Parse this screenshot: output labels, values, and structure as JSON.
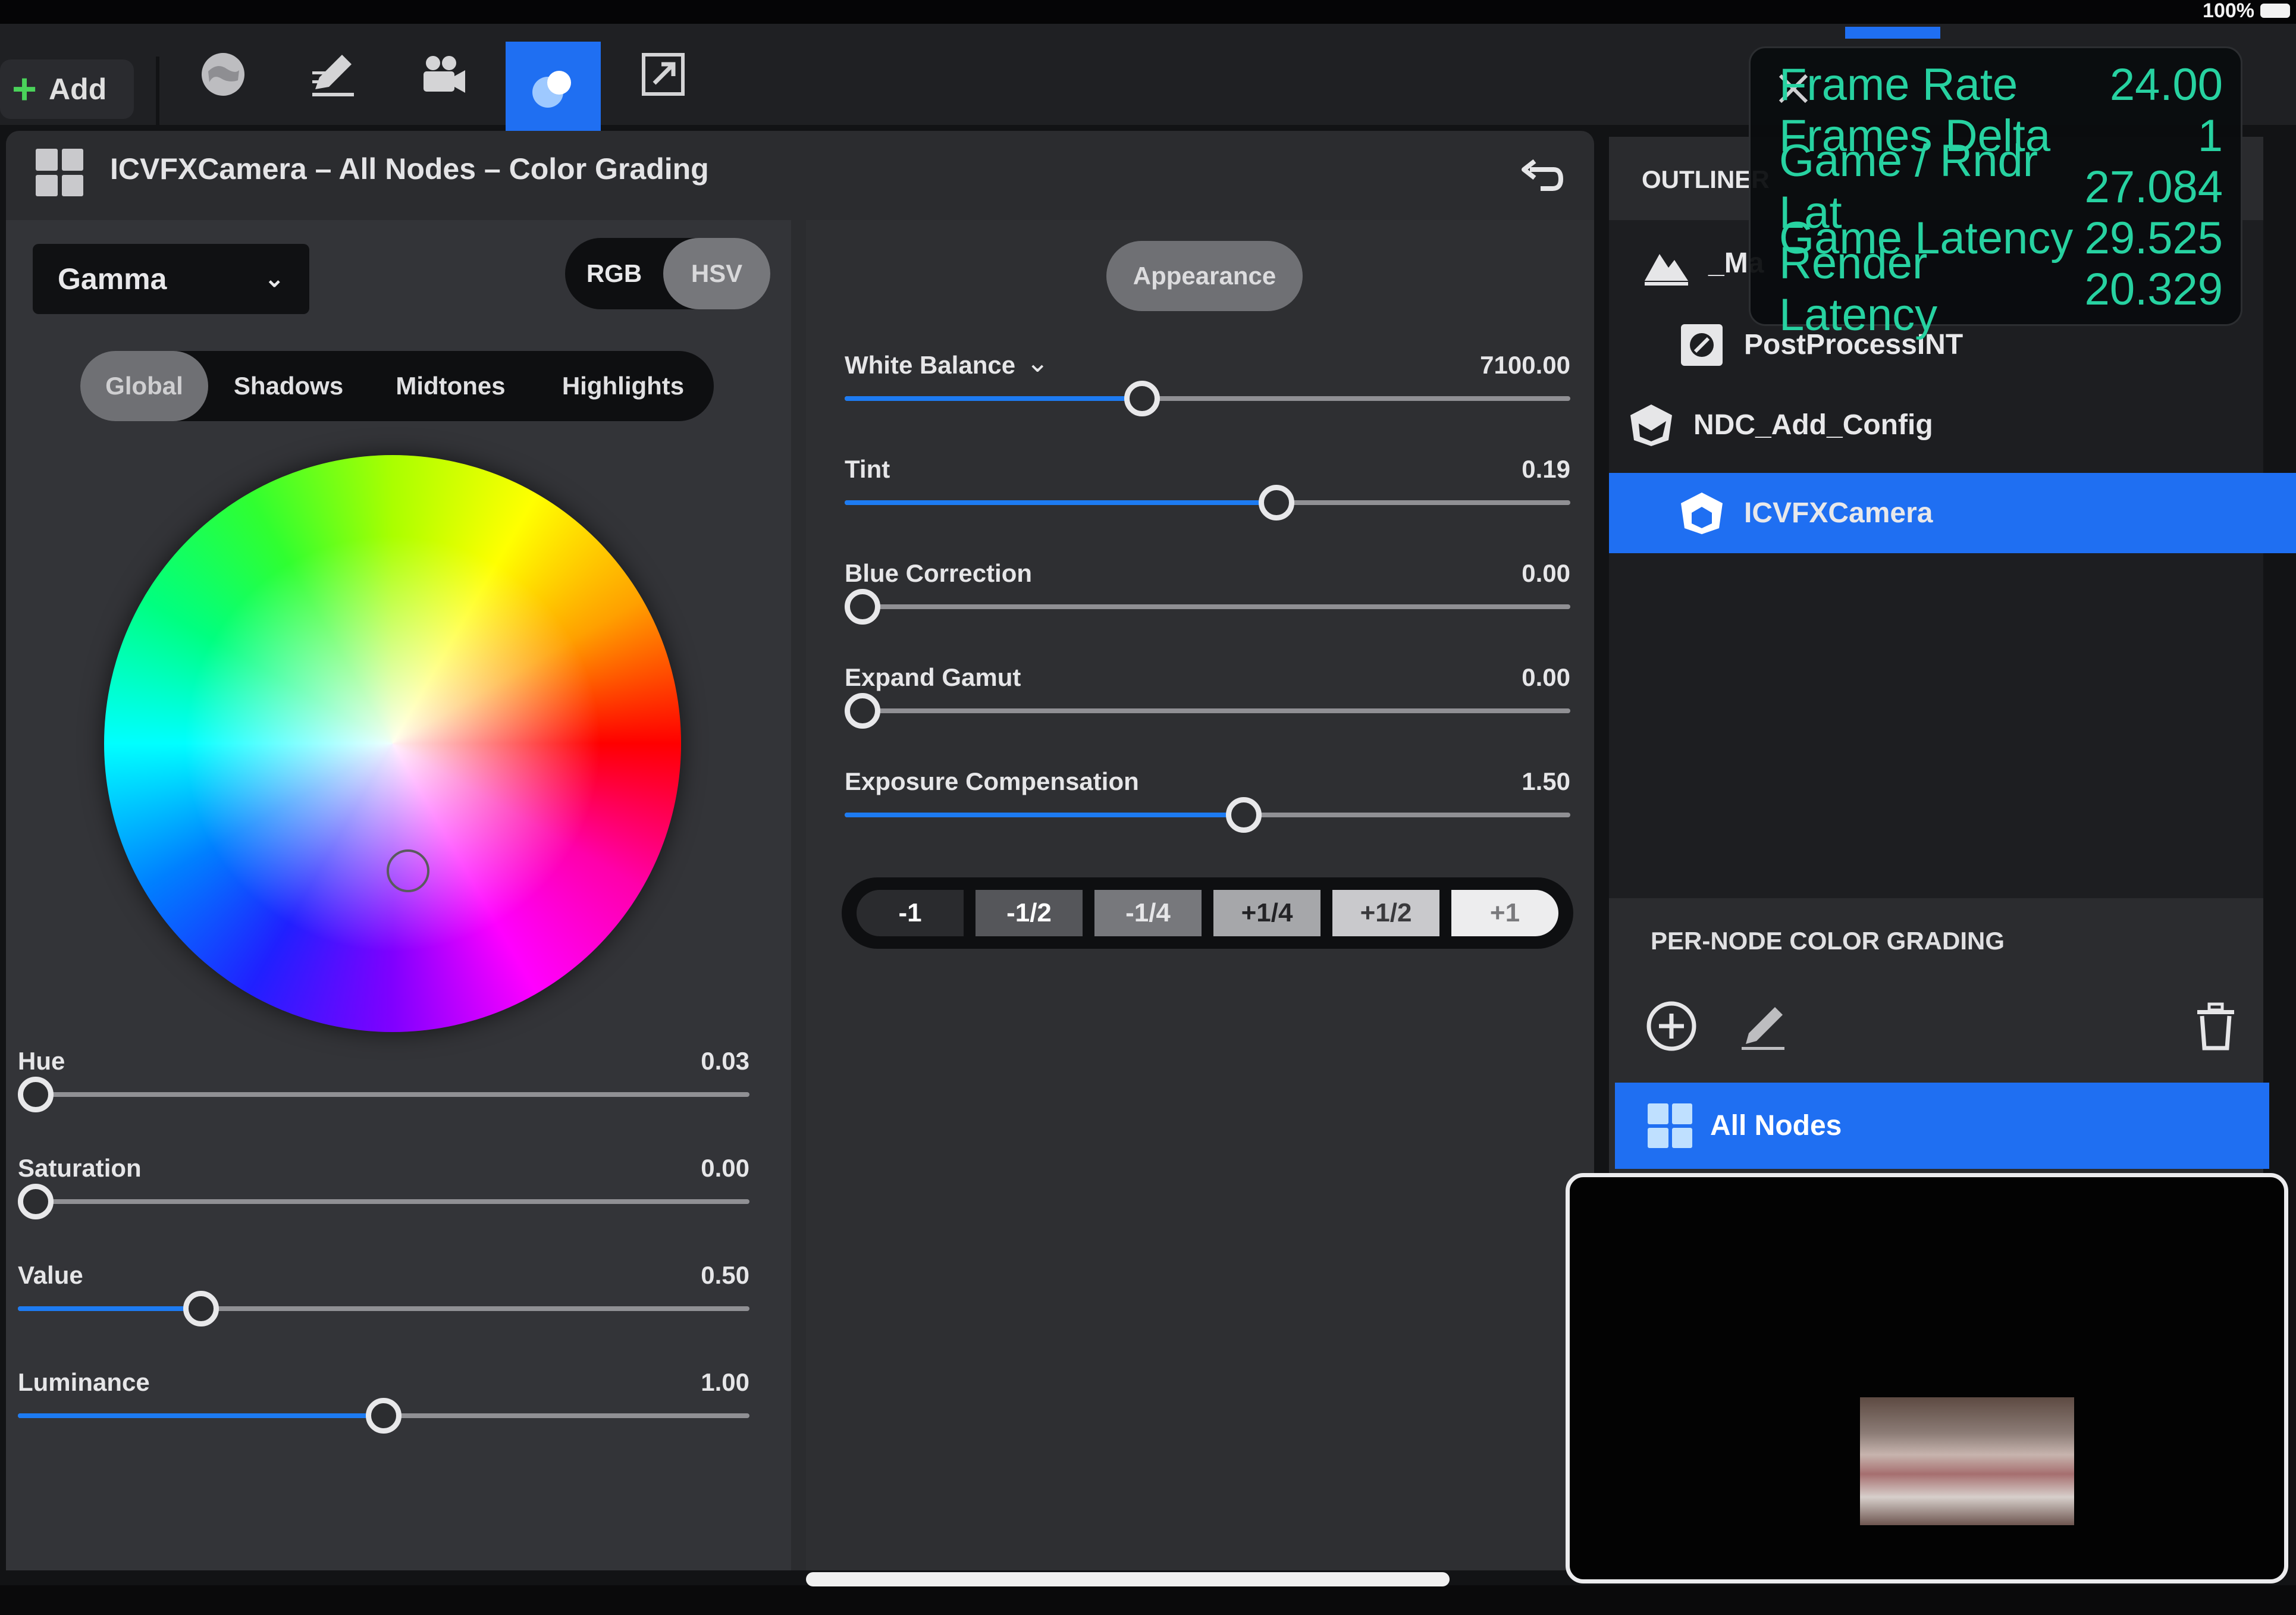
{
  "status": {
    "battery_pct": "100%"
  },
  "toolbar": {
    "add_label": "Add",
    "tools": [
      "globe-icon",
      "edit-icon",
      "camera-icon",
      "color-grading-icon",
      "export-icon"
    ],
    "active_tool": "color-grading-icon",
    "accent": "#1f6ff2"
  },
  "panel": {
    "title": "ICVFXCamera – All Nodes – Color Grading"
  },
  "grading": {
    "mode": "Gamma",
    "color_models": [
      "RGB",
      "HSV"
    ],
    "active_color_model": "HSV",
    "ranges": [
      "Global",
      "Shadows",
      "Midtones",
      "Highlights"
    ],
    "active_range": "Global",
    "wheel_sliders": [
      {
        "label": "Hue",
        "value": "0.03",
        "fill": 0.0
      },
      {
        "label": "Saturation",
        "value": "0.00",
        "fill": 0.0
      },
      {
        "label": "Value",
        "value": "0.50",
        "fill": 0.25
      },
      {
        "label": "Luminance",
        "value": "1.00",
        "fill": 0.5
      }
    ]
  },
  "appearance": {
    "tab_label": "Appearance",
    "sliders": [
      {
        "label": "White Balance",
        "value": "7100.00",
        "fill": 0.41,
        "has_dropdown": true
      },
      {
        "label": "Tint",
        "value": "0.19",
        "fill": 0.595
      },
      {
        "label": "Blue Correction",
        "value": "0.00",
        "fill": 0.0
      },
      {
        "label": "Expand Gamut",
        "value": "0.00",
        "fill": 0.0
      },
      {
        "label": "Exposure Compensation",
        "value": "1.50",
        "fill": 0.55
      }
    ],
    "exposure_steps": [
      {
        "label": "-1",
        "bg": "#2a2b2e",
        "fg": "#ffffff"
      },
      {
        "label": "-1/2",
        "bg": "#55565a",
        "fg": "#ffffff"
      },
      {
        "label": "-1/4",
        "bg": "#77787c",
        "fg": "#e6e6e8"
      },
      {
        "label": "+1/4",
        "bg": "#a6a7aa",
        "fg": "#232326"
      },
      {
        "label": "+1/2",
        "bg": "#c9c9cc",
        "fg": "#3a3a3d"
      },
      {
        "label": "+1",
        "bg": "#ededee",
        "fg": "#7a7a7d"
      }
    ]
  },
  "outliner": {
    "title": "OUTLINER",
    "items": [
      {
        "label": "_Ma",
        "icon": "landscape-icon"
      },
      {
        "label": "PostProcessINT",
        "icon": "postprocess-icon"
      },
      {
        "label": "NDC_Add_Config",
        "icon": "config-icon"
      },
      {
        "label": "ICVFXCamera",
        "icon": "camera-icon",
        "selected": true
      }
    ]
  },
  "per_node": {
    "title": "PER-NODE COLOR GRADING",
    "all_nodes_label": "All Nodes"
  },
  "stats": [
    {
      "label": "Frame Rate",
      "value": "24.00"
    },
    {
      "label": "Frames Delta",
      "value": "1"
    },
    {
      "label": "Game / Rndr Lat",
      "value": "27.084"
    },
    {
      "label": "Game Latency",
      "value": "29.525"
    },
    {
      "label": "Render Latency",
      "value": "20.329"
    }
  ],
  "stats_color": "#27d2a1"
}
